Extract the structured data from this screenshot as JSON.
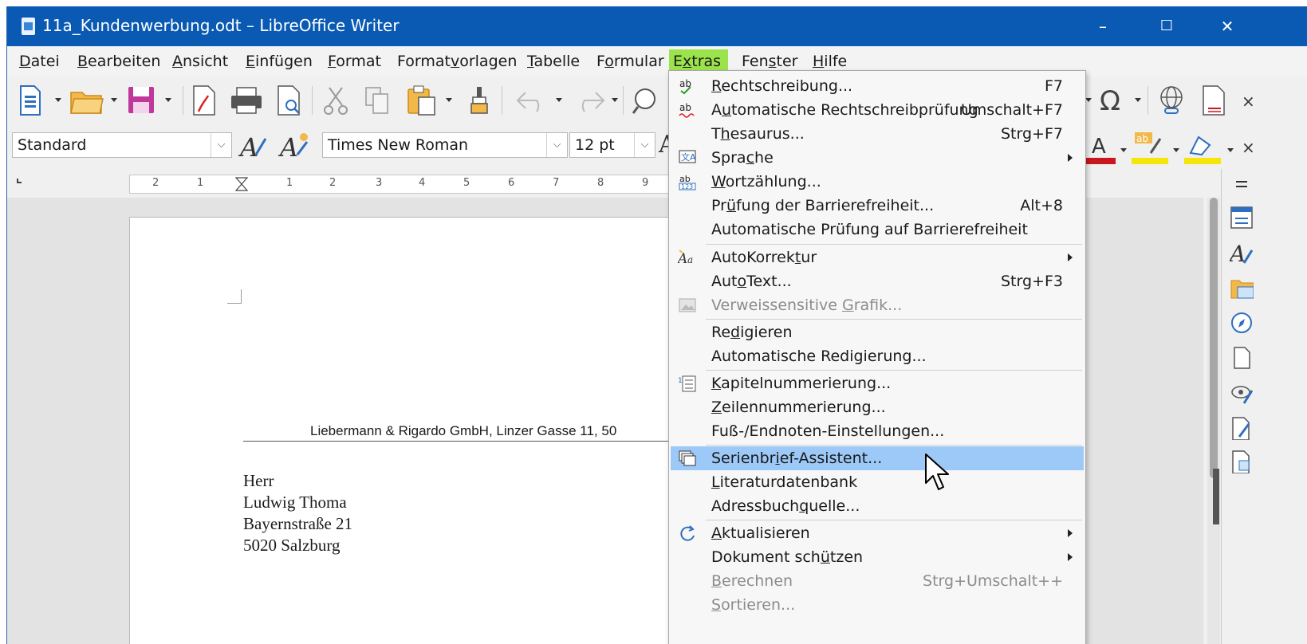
{
  "window": {
    "title": "11a_Kundenwerbung.odt – LibreOffice Writer",
    "controls": {
      "minimize": "–",
      "maximize": "☐",
      "close": "✕"
    }
  },
  "menubar": {
    "items": [
      {
        "pre": "",
        "mnem": "D",
        "post": "atei"
      },
      {
        "pre": "",
        "mnem": "B",
        "post": "earbeiten"
      },
      {
        "pre": "",
        "mnem": "A",
        "post": "nsicht"
      },
      {
        "pre": "",
        "mnem": "E",
        "post": "infügen"
      },
      {
        "pre": "",
        "mnem": "F",
        "post": "ormat"
      },
      {
        "pre": "Format",
        "mnem": "v",
        "post": "orlagen"
      },
      {
        "pre": "",
        "mnem": "T",
        "post": "abelle"
      },
      {
        "pre": "F",
        "mnem": "o",
        "post": "rmular"
      },
      {
        "pre": "E",
        "mnem": "x",
        "post": "tras"
      },
      {
        "pre": "Fen",
        "mnem": "s",
        "post": "ter"
      },
      {
        "pre": "",
        "mnem": "H",
        "post": "ilfe"
      }
    ]
  },
  "formatting": {
    "paragraph_style": "Standard",
    "font_name": "Times New Roman",
    "font_size": "12 pt",
    "partial_letter": "A"
  },
  "ruler": {
    "numbers": [
      "2",
      "1",
      "1",
      "2",
      "3",
      "4",
      "5",
      "6",
      "7",
      "8",
      "9"
    ]
  },
  "document": {
    "sender_line": "Liebermann & Rigardo GmbH,  Linzer Gasse 11, 50",
    "address": [
      "Herr",
      "Ludwig Thoma",
      "Bayernstraße 21",
      "5020 Salzburg"
    ]
  },
  "extras_menu": {
    "items": [
      {
        "pre": "",
        "mnem": "R",
        "post": "echtschreibung...",
        "shortcut": "F7",
        "icon": "spellcheck-icon"
      },
      {
        "pre": "A",
        "mnem": "u",
        "post": "tomatische Rechtschreibprüfung",
        "shortcut": "Umschalt+F7",
        "icon": "auto-spellcheck-icon"
      },
      {
        "pre": "T",
        "mnem": "h",
        "post": "esaurus...",
        "shortcut": "Strg+F7",
        "icon": ""
      },
      {
        "pre": "Spra",
        "mnem": "c",
        "post": "he",
        "shortcut": "",
        "icon": "language-icon",
        "submenu": true
      },
      {
        "pre": "",
        "mnem": "W",
        "post": "ortzählung...",
        "shortcut": "",
        "icon": "word-count-icon"
      },
      {
        "pre": "Pr",
        "mnem": "ü",
        "post": "fung der Barrierefreiheit...",
        "shortcut": "Alt+8",
        "icon": ""
      },
      {
        "pre": "Automatische Prüfung auf Barrierefreiheit",
        "mnem": "",
        "post": "",
        "shortcut": "",
        "icon": ""
      },
      {
        "pre": "AutoKorrek",
        "mnem": "t",
        "post": "ur",
        "shortcut": "",
        "icon": "autocorrect-icon",
        "submenu": true
      },
      {
        "pre": "Aut",
        "mnem": "o",
        "post": "Text...",
        "shortcut": "Strg+F3",
        "icon": ""
      },
      {
        "pre": "Verweissensitive ",
        "mnem": "G",
        "post": "rafik...",
        "shortcut": "",
        "icon": "image-map-icon",
        "disabled": true
      },
      {
        "pre": "Re",
        "mnem": "d",
        "post": "igieren",
        "shortcut": "",
        "icon": ""
      },
      {
        "pre": "Automatische Redigierung...",
        "mnem": "",
        "post": "",
        "shortcut": "",
        "icon": ""
      },
      {
        "pre": "",
        "mnem": "K",
        "post": "apitelnummerierung...",
        "shortcut": "",
        "icon": "chapter-numbering-icon"
      },
      {
        "pre": "",
        "mnem": "Z",
        "post": "eilennummerierung...",
        "shortcut": "",
        "icon": ""
      },
      {
        "pre": "Fuß-/Endnoten-Einstellungen...",
        "mnem": "",
        "post": "",
        "shortcut": "",
        "icon": ""
      },
      {
        "pre": "Serienbr",
        "mnem": "i",
        "post": "ef-Assistent...",
        "shortcut": "",
        "icon": "mail-merge-icon",
        "highlighted": true
      },
      {
        "pre": "",
        "mnem": "L",
        "post": "iteraturdatenbank",
        "shortcut": "",
        "icon": ""
      },
      {
        "pre": "Adressbuch",
        "mnem": "q",
        "post": "uelle...",
        "shortcut": "",
        "icon": ""
      },
      {
        "pre": "",
        "mnem": "A",
        "post": "ktualisieren",
        "shortcut": "",
        "icon": "update-icon",
        "submenu": true
      },
      {
        "pre": "Dokument sch",
        "mnem": "ü",
        "post": "tzen",
        "shortcut": "",
        "icon": "",
        "submenu": true
      },
      {
        "pre": "",
        "mnem": "B",
        "post": "erechnen",
        "shortcut": "Strg+Umschalt++",
        "icon": "",
        "disabled": true
      },
      {
        "pre": "",
        "mnem": "S",
        "post": "ortieren...",
        "shortcut": "",
        "icon": "",
        "disabled": true
      }
    ]
  },
  "colors": {
    "titlebar": "#0a5ab4",
    "menu_active": "#9be34b",
    "menu_highlight": "#9cc9f7",
    "font_color_bar": "#c8181e",
    "highlight_bar": "#f5e50a"
  }
}
